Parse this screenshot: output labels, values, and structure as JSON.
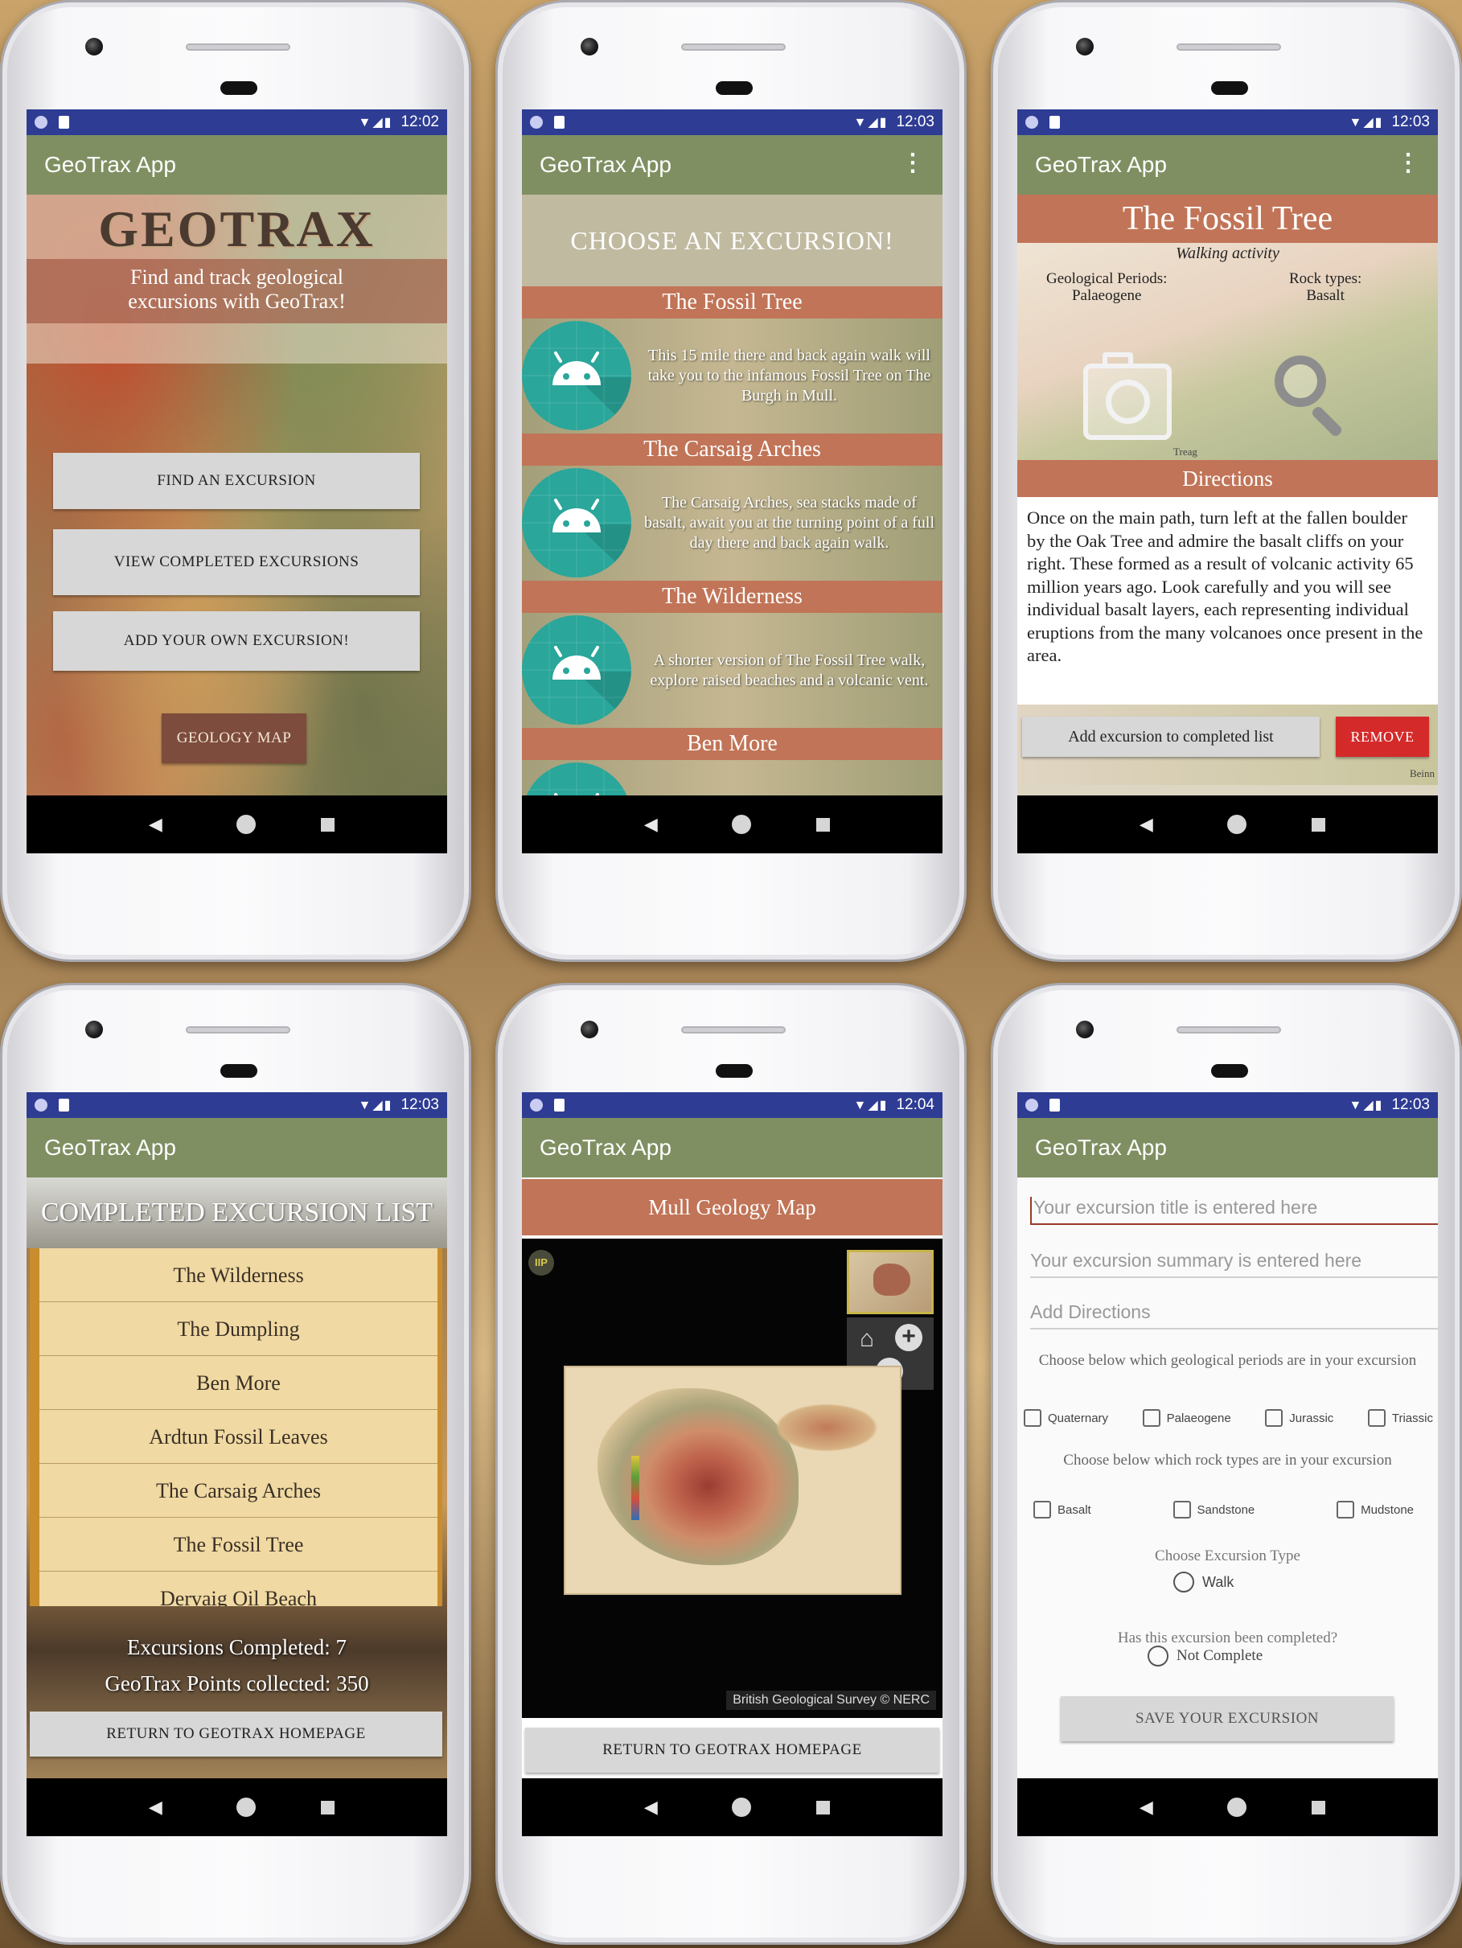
{
  "status_bar": {
    "times": [
      "12:02",
      "12:03",
      "12:03",
      "12:03",
      "12:04",
      "12:03"
    ]
  },
  "app_title": "GeoTrax App",
  "home": {
    "logo": "GEOTRAX",
    "tagline_line1": "Find and track geological",
    "tagline_line2": "excursions with GeoTrax!",
    "buttons": [
      "FIND AN EXCURSION",
      "VIEW COMPLETED EXCURSIONS",
      "ADD YOUR OWN EXCURSION!"
    ],
    "map_button": "GEOLOGY MAP"
  },
  "choose": {
    "heading": "CHOOSE AN EXCURSION!",
    "items": [
      {
        "title": "The Fossil Tree",
        "desc": "This 15 mile there and back again walk will take you to the infamous Fossil Tree on The Burgh in Mull."
      },
      {
        "title": "The Carsaig Arches",
        "desc": "The Carsaig Arches, sea stacks made of basalt, await you at the turning point of a full day there and back again walk."
      },
      {
        "title": "The Wilderness",
        "desc": "A shorter version of The Fossil Tree walk, explore raised beaches and a volcanic vent."
      },
      {
        "title": "Ben More",
        "desc": ""
      }
    ]
  },
  "detail": {
    "title": "The Fossil Tree",
    "activity": "Walking activity",
    "periods_label": "Geological Periods:",
    "periods_value": "Palaeogene",
    "rocks_label": "Rock types:",
    "rocks_value": "Basalt",
    "map_word_1": "Treag",
    "map_word_2": "Beinn",
    "directions_header": "Directions",
    "directions_text": "Once on the main path, turn left at the fallen boulder by the Oak Tree and admire the basalt cliffs on your right. These formed as a result of volcanic activity 65 million years ago. Look carefully and you will see individual basalt layers, each representing individual eruptions from the many volcanoes once present in the area.",
    "add_button": "Add excursion to completed list",
    "remove_button": "REMOVE"
  },
  "completed": {
    "heading": "COMPLETED EXCURSION LIST",
    "items": [
      "The Wilderness",
      "The Dumpling",
      "Ben More",
      "Ardtun Fossil Leaves",
      "The Carsaig Arches",
      "The Fossil Tree",
      "Dervaig Oil Beach"
    ],
    "count_text": "Excursions Completed: 7",
    "points_text": "GeoTrax Points collected: 350",
    "return_button": "RETURN TO GEOTRAX HOMEPAGE"
  },
  "map": {
    "heading": "Mull Geology Map",
    "iip_badge": "IIP",
    "attribution": "British Geological Survey © NERC",
    "return_button": "RETURN TO GEOTRAX HOMEPAGE"
  },
  "add": {
    "title_placeholder": "Your excursion title is entered here",
    "summary_placeholder": "Your excursion summary is entered here",
    "directions_placeholder": "Add Directions",
    "periods_prompt": "Choose below which geological periods are in your excursion",
    "periods": [
      "Quaternary",
      "Palaeogene",
      "Jurassic",
      "Triassic"
    ],
    "rocks_prompt": "Choose below which rock types are in your excursion",
    "rocks": [
      "Basalt",
      "Sandstone",
      "Mudstone"
    ],
    "type_prompt": "Choose Excursion Type",
    "type_option": "Walk",
    "completed_prompt": "Has this excursion been completed?",
    "completed_option": "Not Complete",
    "save_button": "SAVE YOUR EXCURSION"
  },
  "nav_icons": [
    "back-triangle-icon",
    "home-circle-icon",
    "recents-square-icon"
  ],
  "colors": {
    "status_bar": "#2e3c94",
    "app_bar": "#7f8f62",
    "rust": "#c17457",
    "remove": "#d42a2a",
    "completed_item": "#f0d9a2"
  }
}
